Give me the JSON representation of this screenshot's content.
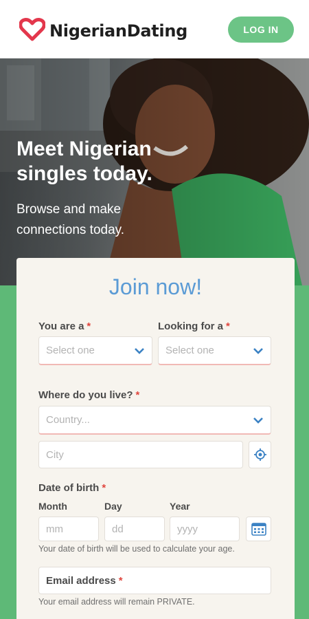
{
  "header": {
    "logo_text": "NigerianDating",
    "logo_icon": "heart-logo-icon",
    "login_label": "LOG IN"
  },
  "hero": {
    "title": "Meet Nigerian singles today.",
    "subtitle": "Browse and make connections today."
  },
  "form": {
    "title": "Join now!",
    "you_are": {
      "label": "You are a",
      "placeholder": "Select one"
    },
    "looking_for": {
      "label": "Looking for a",
      "placeholder": "Select one"
    },
    "location": {
      "label": "Where do you live?",
      "country_placeholder": "Country...",
      "city_placeholder": "City"
    },
    "dob": {
      "label": "Date of birth",
      "month_label": "Month",
      "day_label": "Day",
      "year_label": "Year",
      "month_placeholder": "mm",
      "day_placeholder": "dd",
      "year_placeholder": "yyyy",
      "helper": "Your date of birth will be used to calculate your age."
    },
    "email": {
      "label": "Email address",
      "helper": "Your email address will remain PRIVATE."
    },
    "required_mark": "*"
  },
  "colors": {
    "brand_green": "#5eb977",
    "login_green": "#6cc486",
    "logo_red": "#e3374c",
    "title_blue": "#5b9bd5",
    "required_red": "#e0463e"
  }
}
